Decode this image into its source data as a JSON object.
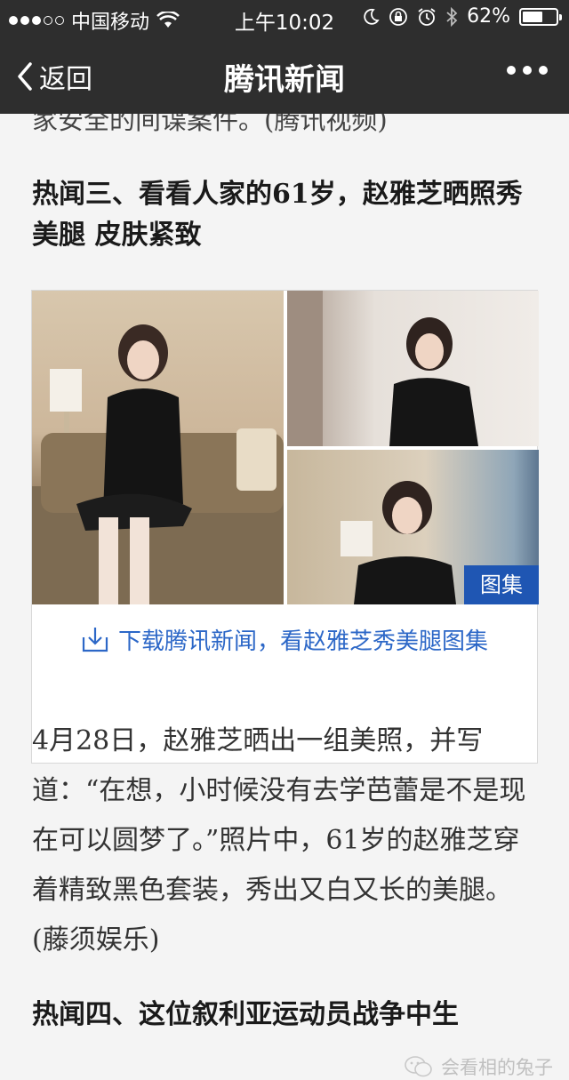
{
  "status_bar": {
    "carrier": "中国移动",
    "time": "上午10:02",
    "battery_percent": "62%",
    "battery_level": 0.62
  },
  "nav": {
    "back_label": "返回",
    "title": "腾讯新闻"
  },
  "article": {
    "prev_line": "家安全的间谍案件。(腾讯视频)",
    "headline": "热闻三、看看人家的61岁，赵雅芝晒照秀美腿 皮肤紧致",
    "gallery_badge": "图集",
    "download_link": "下载腾讯新闻，看赵雅芝秀美腿图集",
    "paragraph": "4月28日，赵雅芝晒出一组美照，并写道：“在想，小时候没有去学芭蕾是不是现在可以圆梦了。”照片中，61岁的赵雅芝穿着精致黑色套装，秀出又白又长的美腿。(藤须娱乐)",
    "next_headline": "热闻四、这位叙利亚运动员战争中生"
  },
  "watermark": {
    "text": "会看相的兔子"
  },
  "icons": {
    "wifi": "wifi-icon",
    "moon": "moon-icon",
    "lock": "rotation-lock-icon",
    "alarm": "alarm-icon",
    "bluetooth": "bluetooth-icon",
    "download": "download-icon",
    "wechat": "wechat-icon"
  },
  "colors": {
    "bar_bg": "#2e2e2e",
    "link_blue": "#2c67c7",
    "badge_blue": "#1f56b3"
  }
}
